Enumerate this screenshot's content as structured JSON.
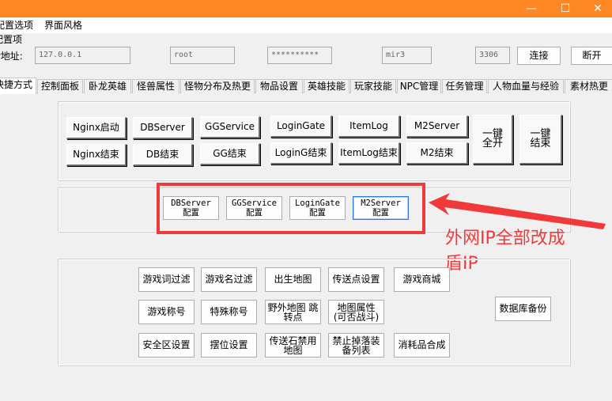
{
  "window": {
    "min_glyph": "—",
    "max_glyph": "☐",
    "close_glyph": "✕"
  },
  "menu": [
    "配置选项",
    "界面风格"
  ],
  "config": {
    "section_label": "配置项",
    "ip_label": "IP地址:",
    "ip_value": "127.0.0.1",
    "user_value": "root",
    "password_value": "**********",
    "db_value": "mir3",
    "port_value": "3306",
    "connect_label": "连接",
    "disconnect_label": "断开"
  },
  "tabs": [
    "快捷方式",
    "控制面板",
    "卧龙英雄",
    "怪兽属性",
    "怪物分布及热更",
    "物品设置",
    "英雄技能",
    "玩家技能",
    "NPC管理",
    "任务管理",
    "人物血量与经验",
    "素材热更"
  ],
  "server_buttons": {
    "nginx_start": "Nginx启动",
    "nginx_stop": "Nginx结束",
    "db_server": "DBServer",
    "db_stop": "DB结束",
    "gg_service": "GGService",
    "gg_stop": "GG结束",
    "login_gate": "LoginGate",
    "login_stop": "LoginG结束",
    "item_log": "ItemLog",
    "item_log_stop": "ItemLog结束",
    "m2_server": "M2Server",
    "m2_stop": "M2结束",
    "start_all": "一键全开",
    "stop_all": "一键结束"
  },
  "config_buttons": {
    "db_config": "DBServer 配置",
    "gg_config": "GGService 配置",
    "login_config": "LoginGate 配置",
    "m2_config": "M2Server 配置"
  },
  "tool_buttons": {
    "word_filter": "游戏词过滤",
    "name_filter": "游戏名过滤",
    "spawn_map": "出生地图",
    "teleport": "传送点设置",
    "shop": "游戏商城",
    "game_title": "游戏称号",
    "special_title": "特殊称号",
    "field_map": "野外地图 跳转点",
    "map_attr": "地图属性(可否战斗)",
    "safe_zone": "安全区设置",
    "stall": "摆位设置",
    "teleport_stone": "传送石禁用地图",
    "drop_ban": "禁止掉落装备列表",
    "consumable": "消耗品合成",
    "backup": "数据库备份"
  },
  "annotation": {
    "line1": "外网IP全部改成",
    "line2": "盾IP"
  },
  "colors": {
    "title_bar": "#fd8723",
    "annotation_red": "#f03a3a",
    "selected_blue": "#2d78d8"
  }
}
